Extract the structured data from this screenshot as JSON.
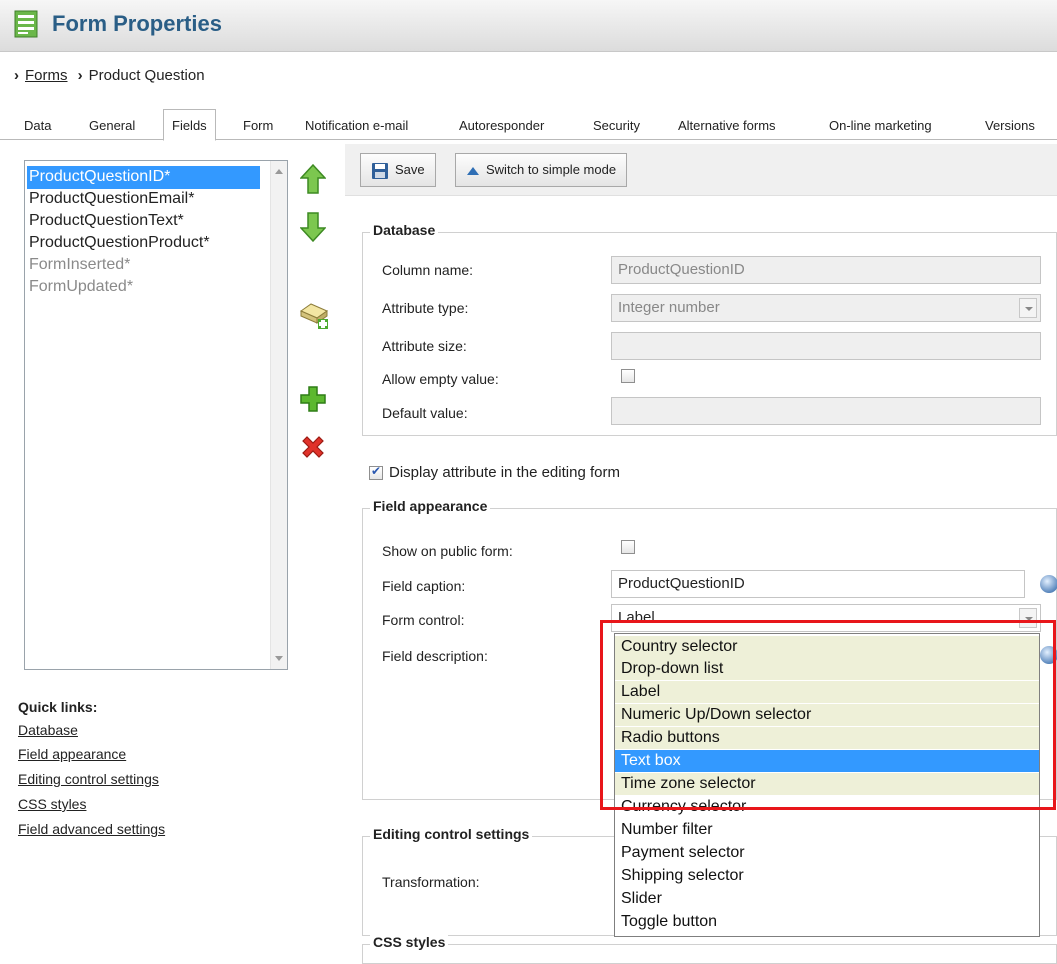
{
  "header": {
    "title": "Form Properties",
    "icon": "form-document-icon"
  },
  "breadcrumb": {
    "link": "Forms",
    "current": "Product Question"
  },
  "tabs": [
    "Data",
    "General",
    "Fields",
    "Form",
    "Notification e-mail",
    "Autoresponder",
    "Security",
    "Alternative forms",
    "On-line marketing",
    "Versions"
  ],
  "active_tab": "Fields",
  "fields": [
    {
      "label": "ProductQuestionID*",
      "state": "selected"
    },
    {
      "label": "ProductQuestionEmail*",
      "state": "normal"
    },
    {
      "label": "ProductQuestionText*",
      "state": "normal"
    },
    {
      "label": "ProductQuestionProduct*",
      "state": "normal"
    },
    {
      "label": "FormInserted*",
      "state": "disabled"
    },
    {
      "label": "FormUpdated*",
      "state": "disabled"
    }
  ],
  "side_icons": [
    "move-up-icon",
    "move-down-icon",
    "new-category-icon",
    "add-field-icon",
    "delete-field-icon"
  ],
  "quick_links": {
    "title": "Quick links:",
    "items": [
      "Database",
      "Field appearance",
      "Editing control settings",
      "CSS styles",
      "Field advanced settings"
    ]
  },
  "toolbar": {
    "save_label": "Save",
    "simple_mode_label": "Switch to simple mode"
  },
  "database": {
    "legend": "Database",
    "column_name_label": "Column name:",
    "column_name_value": "ProductQuestionID",
    "attribute_type_label": "Attribute type:",
    "attribute_type_value": "Integer number",
    "attribute_size_label": "Attribute size:",
    "attribute_size_value": "",
    "allow_empty_label": "Allow empty value:",
    "allow_empty_checked": false,
    "default_value_label": "Default value:",
    "default_value_value": ""
  },
  "display_attribute": {
    "label": "Display attribute in the editing form",
    "checked": true
  },
  "field_appearance": {
    "legend": "Field appearance",
    "show_public_label": "Show on public form:",
    "show_public_checked": false,
    "caption_label": "Field caption:",
    "caption_value": "ProductQuestionID",
    "form_control_label": "Form control:",
    "form_control_value": "Label",
    "description_label": "Field description:"
  },
  "editing_control": {
    "legend": "Editing control settings",
    "transformation_label": "Transformation:"
  },
  "css_styles": {
    "legend": "CSS styles"
  },
  "form_control_options": [
    "Country selector",
    "Drop-down list",
    "Label",
    "Numeric Up/Down selector",
    "Radio buttons",
    "Text box",
    "Time zone selector",
    "Currency selector",
    "Number filter",
    "Payment selector",
    "Shipping selector",
    "Slider",
    "Toggle button"
  ],
  "dropdown_selected": "Text box",
  "colors": {
    "accent": "#3399ff",
    "title": "#2a5e86",
    "highlight_box": "#e8161a",
    "option_highlight": "#eef0d8"
  }
}
